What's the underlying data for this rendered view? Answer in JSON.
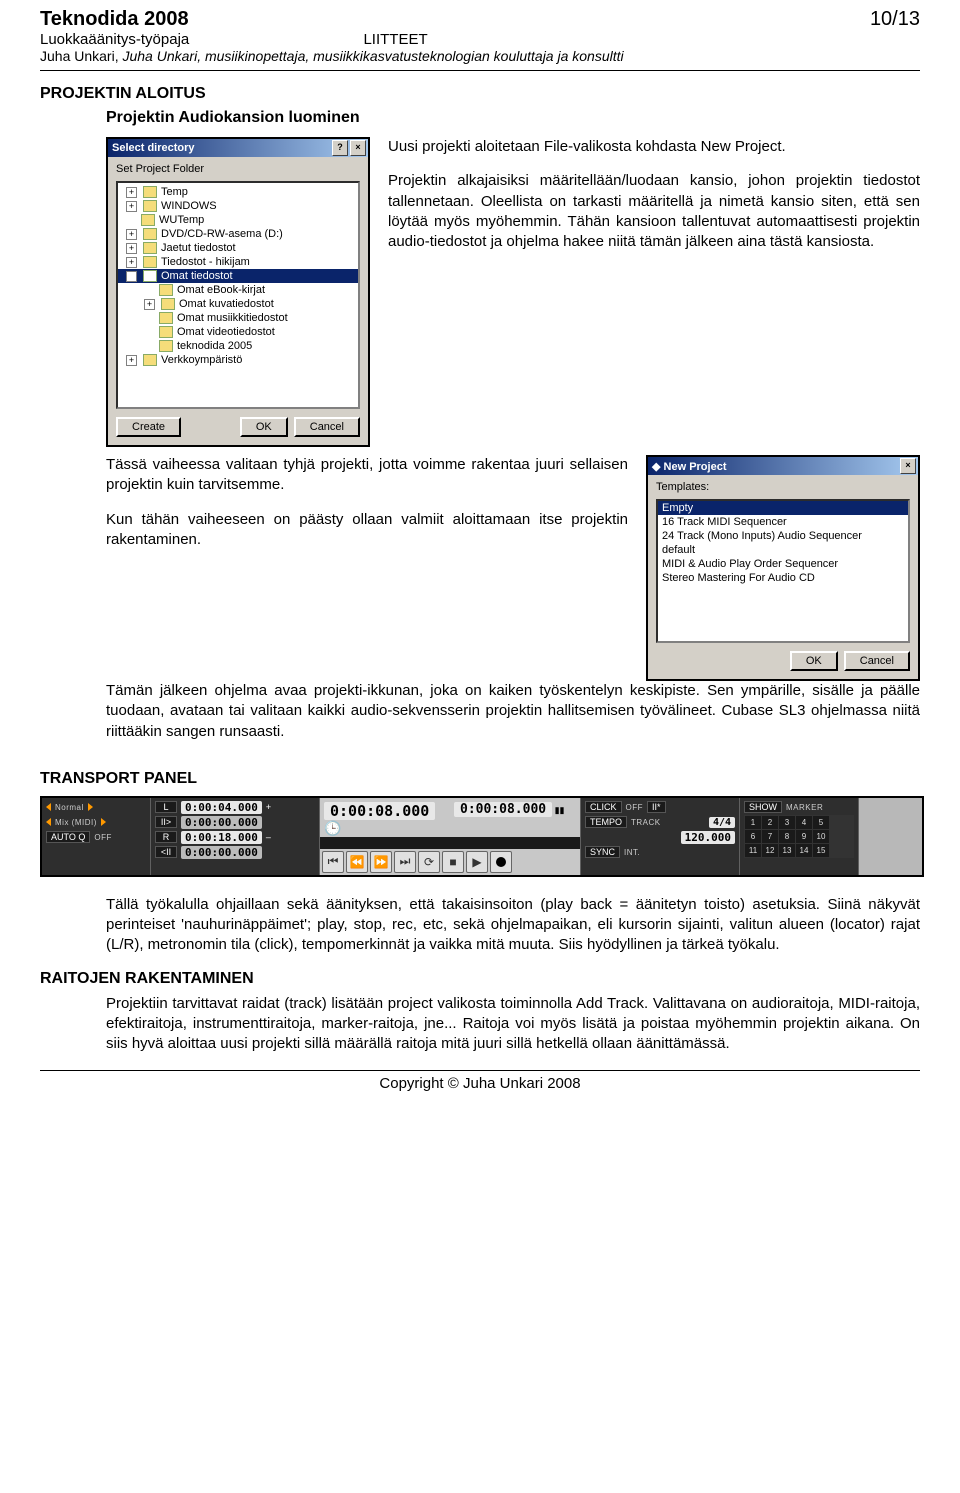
{
  "header": {
    "title": "Teknodida 2008",
    "sub_left": "Luokkaäänitys-työpaja",
    "sub_right": "LIITTEET",
    "author": "Juha Unkari, musiikinopettaja, musiikkikasvatusteknologian kouluttaja ja konsultti",
    "pagenum": "10/13"
  },
  "s1": {
    "heading": "PROJEKTIN ALOITUS",
    "subheading": "Projektin Audiokansion luominen",
    "p1": "Uusi projekti aloitetaan File-valikosta kohdasta New Project.",
    "p2": "Projektin alkajaisiksi määritellään/luodaan kansio, johon projektin tiedostot tallennetaan. Oleellista on tarkasti määritellä ja nimetä kansio siten, että sen löytää myös myöhemmin. Tähän kansioon tallentuvat automaattisesti projektin audio-tiedostot ja ohjelma hakee niitä tämän jälkeen aina tästä kansiosta.",
    "p3": "Tässä vaiheessa valitaan tyhjä projekti, jotta voimme rakentaa juuri sellaisen projektin kuin tarvitsemme.",
    "p4": "Kun tähän vaiheeseen on päästy ollaan valmiit aloittamaan itse projektin rakentaminen.",
    "p5": "Tämän jälkeen ohjelma avaa projekti-ikkunan, joka on kaiken työskentelyn keskipiste. Sen ympärille, sisälle ja päälle tuodaan, avataan tai valitaan kaikki audio-sekvensserin projektin hallitsemisen työvälineet. Cubase SL3 ohjelmassa niitä riittääkin sangen runsaasti."
  },
  "dlg_dir": {
    "title": "Select directory",
    "label": "Set Project Folder",
    "tree": [
      {
        "lvl": 1,
        "pm": "+",
        "name": "Temp"
      },
      {
        "lvl": 1,
        "pm": "+",
        "name": "WINDOWS"
      },
      {
        "lvl": 1,
        "pm": " ",
        "name": "WUTemp"
      },
      {
        "lvl": 1,
        "pm": "+",
        "name": "DVD/CD-RW-asema (D:)"
      },
      {
        "lvl": 1,
        "pm": "+",
        "name": "Jaetut tiedostot"
      },
      {
        "lvl": 1,
        "pm": "+",
        "name": "Tiedostot - hikijam"
      },
      {
        "lvl": 1,
        "pm": "-",
        "name": "Omat tiedostot",
        "sel": true
      },
      {
        "lvl": 2,
        "pm": " ",
        "name": "Omat eBook-kirjat"
      },
      {
        "lvl": 2,
        "pm": "+",
        "name": "Omat kuvatiedostot"
      },
      {
        "lvl": 2,
        "pm": " ",
        "name": "Omat musiikkitiedostot"
      },
      {
        "lvl": 2,
        "pm": " ",
        "name": "Omat videotiedostot"
      },
      {
        "lvl": 2,
        "pm": " ",
        "name": "teknodida 2005"
      },
      {
        "lvl": 1,
        "pm": "+",
        "name": "Verkkoympäristö"
      }
    ],
    "btn_create": "Create",
    "btn_ok": "OK",
    "btn_cancel": "Cancel"
  },
  "dlg_new": {
    "title": "New Project",
    "label": "Templates:",
    "items": [
      {
        "name": "Empty",
        "sel": true
      },
      {
        "name": "16 Track MIDI Sequencer"
      },
      {
        "name": "24 Track (Mono Inputs) Audio Sequencer"
      },
      {
        "name": "default"
      },
      {
        "name": "MIDI & Audio Play Order Sequencer"
      },
      {
        "name": "Stereo Mastering For Audio CD"
      }
    ],
    "btn_ok": "OK",
    "btn_cancel": "Cancel"
  },
  "s2": {
    "heading": "TRANSPORT PANEL",
    "p1": "Tällä työkalulla ohjaillaan sekä äänityksen, että takaisinsoiton (play back = äänitetyn toisto) asetuksia. Siinä näkyvät perinteiset 'nauhurinäppäimet'; play, stop, rec, etc, sekä ohjelmapaikan, eli kursorin sijainti, valitun alueen (locator) rajat (L/R), metronomin tila (click), tempomerkinnät ja vaikka mitä muuta. Siis hyödyllinen ja tärkeä työkalu."
  },
  "transport": {
    "col1": {
      "r1_label": "Normal",
      "r1_val": "",
      "r2_label": "Mix (MIDI)",
      "r2_val": "",
      "r3_label": "AUTO Q",
      "r3_val": "OFF"
    },
    "col2": {
      "time_top": "0:00:04.000",
      "time_mid": "0:00:00.000",
      "time_big": "0:00:18.000",
      "time_bot": "0:00:00.000",
      "mark_top": "L",
      "mark_mid": "II>",
      "mark_big": "R",
      "plus": "+",
      "minus": "–"
    },
    "col3": {
      "big_time": "0:00:08.000",
      "clock_icon": "clock-icon"
    },
    "col4": {
      "big_time": "0:00:08.000",
      "bars_icon": "bars-icon"
    },
    "buttons": [
      "|<",
      "<<",
      ">>",
      ">|",
      "cycle",
      "stop",
      "play",
      "rec"
    ],
    "col6": {
      "click_lbl": "CLICK",
      "click_val": "OFF",
      "tempo_lbl": "TEMPO",
      "tempo_val": "TRACK",
      "sig": "4/4",
      "bpm": "120.000",
      "sync_lbl": "SYNC",
      "sync_val": "INT."
    },
    "col7": {
      "show_lbl": "SHOW",
      "marker_lbl": "MARKER",
      "nums": [
        "1",
        "2",
        "3",
        "4",
        "5",
        "6",
        "7",
        "8",
        "9",
        "10",
        "11",
        "12",
        "13",
        "14",
        "15"
      ]
    }
  },
  "s3": {
    "heading": "RAITOJEN RAKENTAMINEN",
    "p1": "Projektiin tarvittavat raidat (track) lisätään project valikosta toiminnolla Add Track. Valittavana on audioraitoja, MIDI-raitoja, efektiraitoja, instrumenttiraitoja, marker-raitoja, jne... Raitoja voi myös lisätä ja poistaa myöhemmin projektin aikana. On siis hyvä aloittaa uusi projekti sillä määrällä raitoja mitä juuri sillä hetkellä ollaan äänittämässä."
  },
  "footer": "Copyright © Juha Unkari 2008"
}
